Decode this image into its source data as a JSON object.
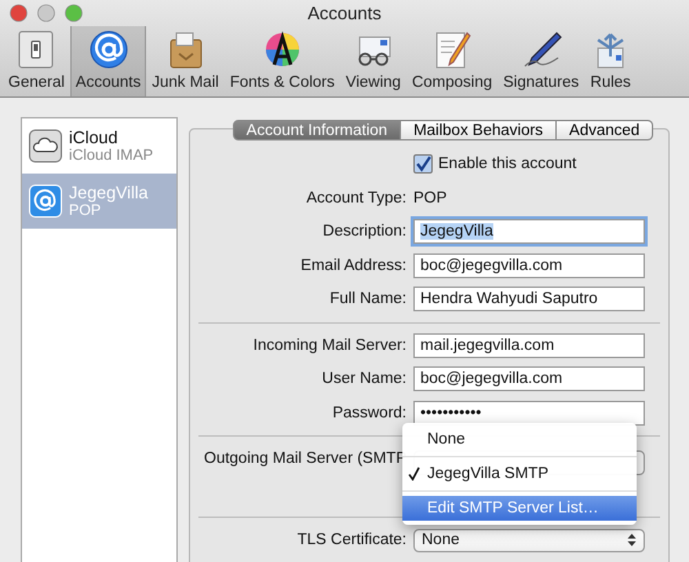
{
  "window": {
    "title": "Accounts"
  },
  "toolbar": [
    {
      "label": "General",
      "selected": false
    },
    {
      "label": "Accounts",
      "selected": true
    },
    {
      "label": "Junk Mail",
      "selected": false
    },
    {
      "label": "Fonts & Colors",
      "selected": false
    },
    {
      "label": "Viewing",
      "selected": false
    },
    {
      "label": "Composing",
      "selected": false
    },
    {
      "label": "Signatures",
      "selected": false
    },
    {
      "label": "Rules",
      "selected": false
    }
  ],
  "accounts": [
    {
      "name": "iCloud",
      "type": "iCloud IMAP",
      "selected": false
    },
    {
      "name": "JegegVilla",
      "type": "POP",
      "selected": true
    }
  ],
  "tabs": [
    {
      "label": "Account Information",
      "selected": true
    },
    {
      "label": "Mailbox Behaviors",
      "selected": false
    },
    {
      "label": "Advanced",
      "selected": false
    }
  ],
  "rows": [
    {
      "kind": "checkbox",
      "label": "Enable this account",
      "checked": true
    },
    {
      "kind": "static",
      "label": "Account Type:",
      "value": "POP"
    },
    {
      "kind": "field",
      "label": "Description:",
      "value": "JegegVilla",
      "focused": true
    },
    {
      "kind": "field",
      "label": "Email Address:",
      "value": "boc@jegegvilla.com",
      "focused": false
    },
    {
      "kind": "field",
      "label": "Full Name:",
      "value": "Hendra Wahyudi Saputro",
      "focused": false
    },
    {
      "kind": "separator"
    },
    {
      "kind": "field",
      "label": "Incoming Mail Server:",
      "value": "mail.jegegvilla.com",
      "focused": false
    },
    {
      "kind": "field",
      "label": "User Name:",
      "value": "boc@jegegvilla.com",
      "focused": false
    },
    {
      "kind": "field",
      "label": "Password:",
      "value": "•••••••••••",
      "focused": false
    },
    {
      "kind": "separator"
    },
    {
      "kind": "covered",
      "label": "Outgoing Mail Server (SMTP"
    },
    {
      "kind": "separator"
    },
    {
      "kind": "popup",
      "label": "TLS Certificate:",
      "value": "None"
    }
  ],
  "menu": [
    {
      "label": "None",
      "checked": false,
      "selected": false
    },
    {
      "label": "JegegVilla SMTP",
      "checked": true,
      "selected": false
    },
    {
      "label": "Edit SMTP Server List…",
      "checked": false,
      "selected": true
    }
  ]
}
